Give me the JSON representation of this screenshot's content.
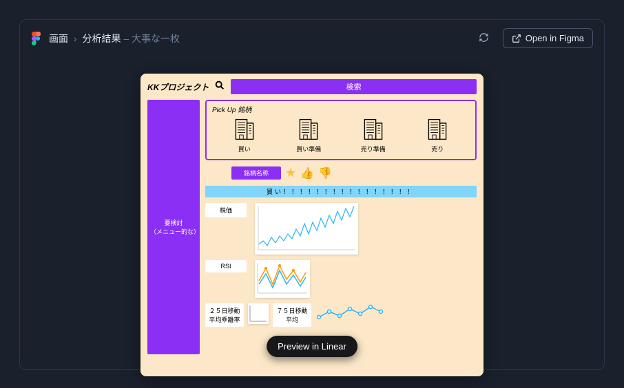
{
  "header": {
    "crumb1": "画面",
    "crumb2": "分析結果",
    "crumb_tail": "大事な一枚",
    "open_label": "Open in Figma"
  },
  "mockup": {
    "app_title": "KKプロジェクト",
    "search_label": "検索",
    "sidebar_line1": "要検討",
    "sidebar_line2": "（メニュー的な）",
    "pickup_title": "Pick Up 銘柄",
    "pickup_items": [
      "買い",
      "買い準備",
      "売り準備",
      "売り"
    ],
    "stock_name_label": "銘柄名称",
    "status_text": "買い！！！！！！！！！！！！！！！！",
    "label_price": "株価",
    "label_rsi": "RSI",
    "label_ma25": "２５日移動平均乖離率",
    "label_ma75": "７５日移動平均"
  },
  "badge": "Preview in Linear"
}
